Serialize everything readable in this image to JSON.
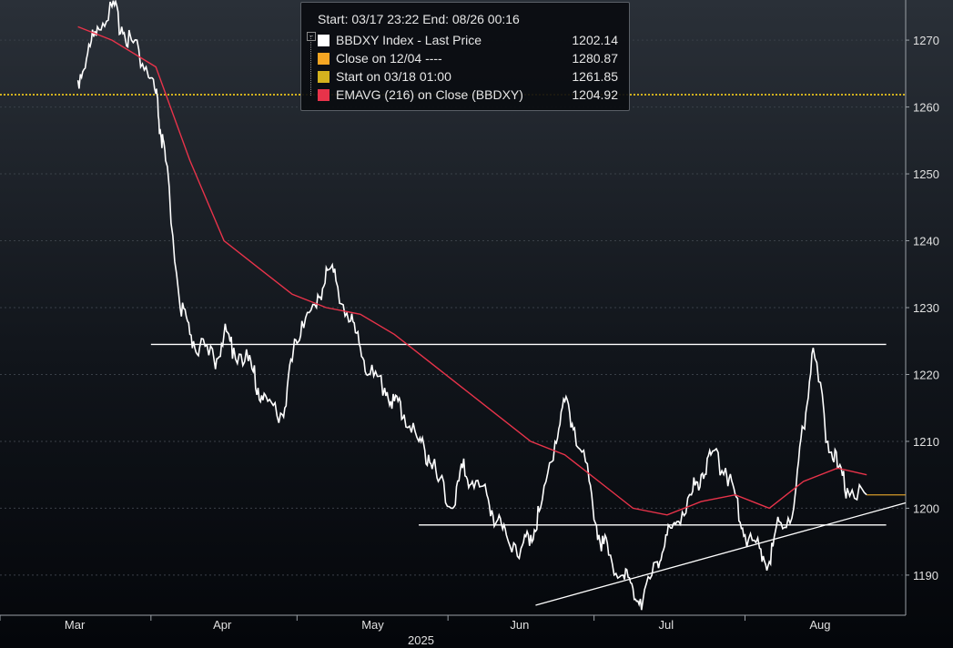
{
  "legend": {
    "range": "Start: 03/17 23:22 End: 08/26 00:16",
    "entries": [
      {
        "label": "BBDXY Index - Last Price",
        "value": "1202.14",
        "color": "#ffffff"
      },
      {
        "label": "Close on 12/04 ----",
        "value": "1280.87",
        "color": "#f5a623"
      },
      {
        "label": "Start on 03/18 01:00",
        "value": "1261.85",
        "color": "#d4b21e"
      },
      {
        "label": "EMAVG (216)  on Close (BBDXY)",
        "value": "1204.92",
        "color": "#e8334a"
      }
    ]
  },
  "chart_data": {
    "type": "line",
    "title": "",
    "xlabel": "2025",
    "ylabel": "",
    "ylim": [
      1184,
      1276
    ],
    "yticks": [
      1190,
      1200,
      1210,
      1220,
      1230,
      1240,
      1250,
      1260,
      1270
    ],
    "xticks": [
      "Mar",
      "Apr",
      "May",
      "Jun",
      "Jul",
      "Aug"
    ],
    "year_label": "2025",
    "grid": true,
    "series": [
      {
        "name": "BBDXY Index - Last Price",
        "color": "#ffffff",
        "x": [
          "03/17",
          "03/19",
          "03/21",
          "03/24",
          "03/26",
          "03/28",
          "03/31",
          "04/02",
          "04/03",
          "04/04",
          "04/07",
          "04/09",
          "04/11",
          "04/14",
          "04/16",
          "04/18",
          "04/21",
          "04/23",
          "04/25",
          "04/28",
          "04/30",
          "05/02",
          "05/05",
          "05/07",
          "05/09",
          "05/12",
          "05/14",
          "05/16",
          "05/19",
          "05/21",
          "05/23",
          "05/26",
          "05/28",
          "05/30",
          "06/02",
          "06/04",
          "06/06",
          "06/09",
          "06/11",
          "06/13",
          "06/16",
          "06/18",
          "06/20",
          "06/23",
          "06/25",
          "06/27",
          "06/30",
          "07/02",
          "07/04",
          "07/07",
          "07/09",
          "07/11",
          "07/14",
          "07/16",
          "07/18",
          "07/21",
          "07/23",
          "07/25",
          "07/28",
          "07/30",
          "08/01",
          "08/04",
          "08/06",
          "08/08",
          "08/11",
          "08/13",
          "08/15",
          "08/18",
          "08/20",
          "08/22",
          "08/26"
        ],
        "values": [
          1264,
          1268,
          1272,
          1275,
          1272,
          1270,
          1266,
          1262,
          1256,
          1252,
          1230,
          1226,
          1224,
          1222,
          1226,
          1224,
          1222,
          1218,
          1216,
          1214,
          1222,
          1228,
          1230,
          1236,
          1234,
          1228,
          1224,
          1220,
          1218,
          1216,
          1214,
          1210,
          1208,
          1204,
          1200,
          1206,
          1204,
          1202,
          1198,
          1196,
          1194,
          1196,
          1200,
          1210,
          1216,
          1212,
          1204,
          1196,
          1193,
          1190,
          1188,
          1186,
          1192,
          1196,
          1198,
          1202,
          1205,
          1208,
          1206,
          1202,
          1196,
          1194,
          1192,
          1198,
          1200,
          1212,
          1224,
          1210,
          1206,
          1203,
          1202
        ]
      },
      {
        "name": "EMAVG (216)  on Close (BBDXY)",
        "color": "#e8334a",
        "x": [
          "03/17",
          "03/24",
          "04/02",
          "04/09",
          "04/16",
          "04/23",
          "04/30",
          "05/07",
          "05/14",
          "05/21",
          "05/28",
          "06/04",
          "06/11",
          "06/18",
          "06/25",
          "07/02",
          "07/09",
          "07/16",
          "07/23",
          "07/30",
          "08/06",
          "08/13",
          "08/20",
          "08/26"
        ],
        "values": [
          1272,
          1270,
          1266,
          1252,
          1240,
          1236,
          1232,
          1230,
          1229,
          1226,
          1222,
          1218,
          1214,
          1210,
          1208,
          1204,
          1200,
          1199,
          1201,
          1202,
          1200,
          1204,
          1206,
          1205
        ]
      }
    ],
    "reference_lines": [
      {
        "value": 1261.85,
        "color": "#d4b21e",
        "style": "dotted"
      },
      {
        "value": 1224.5,
        "color": "#ffffff",
        "style": "solid",
        "from": "04/01",
        "to": "08/30"
      },
      {
        "value": 1197.5,
        "color": "#ffffff",
        "style": "solid",
        "from": "05/26",
        "to": "08/30"
      }
    ]
  }
}
